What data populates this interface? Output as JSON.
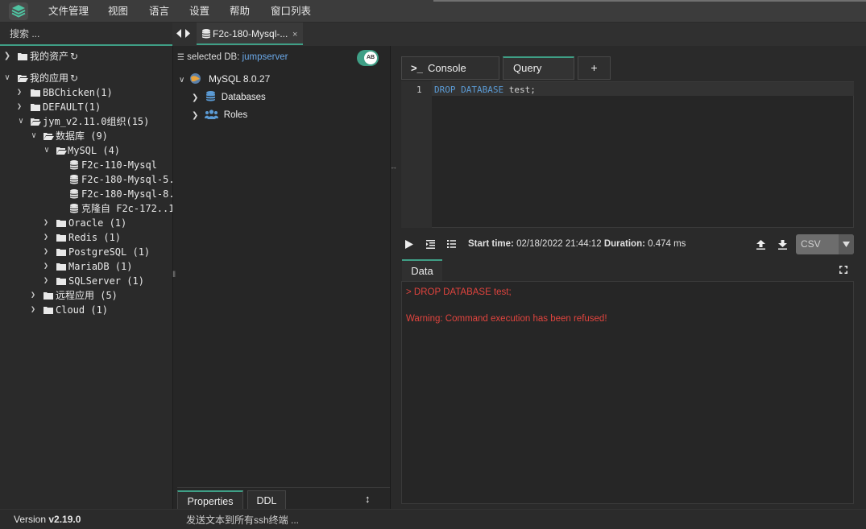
{
  "menubar": {
    "items": [
      "文件管理",
      "视图",
      "语言",
      "设置",
      "帮助",
      "窗口列表"
    ]
  },
  "sidebar": {
    "search_placeholder": "搜索 ...",
    "tree": [
      {
        "label": "我的资产"
      },
      {
        "label": "我的应用"
      },
      {
        "label": "BBChicken(1)"
      },
      {
        "label": "DEFAULT(1)"
      },
      {
        "label": "jym_v2.11.0组织(15)"
      },
      {
        "label": "数据库 (9)"
      },
      {
        "label": "MySQL (4)"
      },
      {
        "label": "F2c-110-Mysql"
      },
      {
        "label": "F2c-180-Mysql-5."
      },
      {
        "label": "F2c-180-Mysql-8."
      },
      {
        "label": "克隆自 F2c-172..1"
      },
      {
        "label": "Oracle (1)"
      },
      {
        "label": "Redis (1)"
      },
      {
        "label": "PostgreSQL (1)"
      },
      {
        "label": "MariaDB (1)"
      },
      {
        "label": "SQLServer (1)"
      },
      {
        "label": "远程应用 (5)"
      },
      {
        "label": "Cloud (1)"
      }
    ],
    "version_label": "Version",
    "version_value": "v2.19.0"
  },
  "tabs": {
    "active_tab": "F2c-180-Mysql-...",
    "close_glyph": "×"
  },
  "db_panel": {
    "selected_db_label": "selected DB:",
    "selected_db_value": "jumpserver",
    "toggle_text": "AB",
    "server": "MySQL 8.0.27",
    "nodes": [
      "Databases",
      "Roles"
    ],
    "bottom_tabs": [
      "Properties",
      "DDL"
    ]
  },
  "editor": {
    "tabs": {
      "console": "Console",
      "query": "Query",
      "add": "+"
    },
    "line_number": "1",
    "sql_keywords": "DROP DATABASE",
    "sql_rest": " test;",
    "start_time_label": "Start time:",
    "start_time_value": "02/18/2022 21:44:12",
    "duration_label": "Duration:",
    "duration_value": "0.474 ms",
    "export_format": "CSV",
    "result_tab": "Data",
    "result_lines": [
      "> DROP DATABASE test;",
      "Warning: Command execution has been refused!"
    ]
  },
  "statusbar": {
    "text": "发送文本到所有ssh终端 ..."
  },
  "colors": {
    "accent": "#3f9f86",
    "error": "#e0443e",
    "sql_keyword": "#5b9bd5",
    "link": "#6aa8e8"
  }
}
